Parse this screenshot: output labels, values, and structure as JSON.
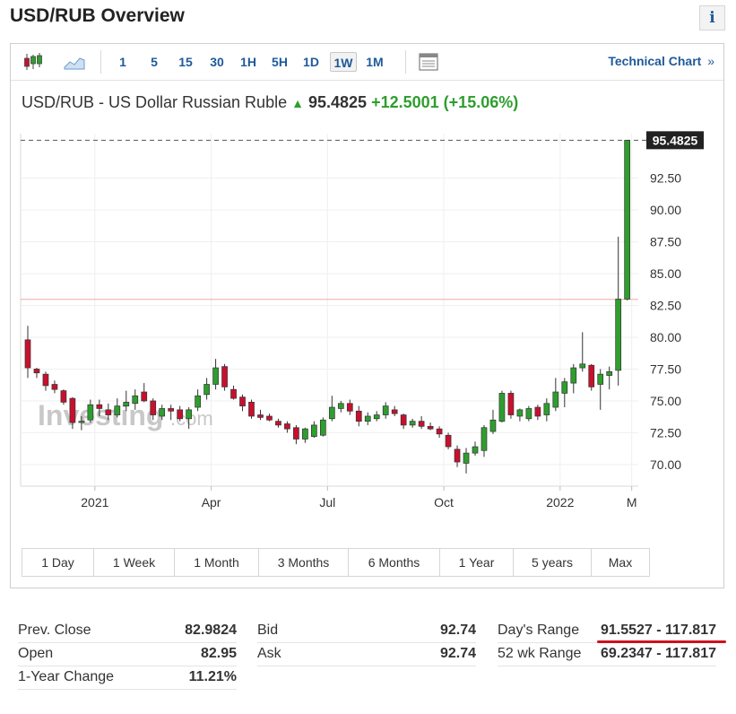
{
  "page": {
    "title": "USD/RUB Overview",
    "info_icon": "i"
  },
  "toolbar": {
    "candles_icon": "candlestick-chart-icon",
    "area_icon": "area-chart-icon",
    "intervals": [
      "1",
      "5",
      "15",
      "30",
      "1H",
      "5H",
      "1D",
      "1W",
      "1M"
    ],
    "active_interval": "1W",
    "layout_icon": "chart-layout-icon",
    "technical_link": "Technical Chart",
    "technical_arrow": "»"
  },
  "header": {
    "name": "USD/RUB - US Dollar Russian Ruble",
    "arrow": "▲",
    "price": "95.4825",
    "change": "+12.5001",
    "change_pct": "(+15.06%)"
  },
  "colors": {
    "up": "#2e9e2e",
    "down": "#c8102e",
    "link": "#1f5a99",
    "prev_close_line": "#f2a8a8"
  },
  "watermark": {
    "text": "Investing",
    "suffix": ".com"
  },
  "chart_data": {
    "type": "candlestick",
    "title": "",
    "ylim": [
      68.3,
      96.0
    ],
    "y_ticks": [
      "70.00",
      "72.50",
      "75.00",
      "77.50",
      "80.00",
      "82.50",
      "85.00",
      "87.50",
      "90.00",
      "92.50"
    ],
    "y_tick_values": [
      70,
      72.5,
      75,
      77.5,
      80,
      82.5,
      85,
      87.5,
      90,
      92.5
    ],
    "x_ticks": [
      "2021",
      "Apr",
      "Jul",
      "Oct",
      "2022",
      "M"
    ],
    "x_tick_index": [
      8,
      21,
      34,
      47,
      60,
      68
    ],
    "last_price_label": "95.4825",
    "last_price": 95.4825,
    "prev_close": 82.9824,
    "grid": true,
    "candles": [
      {
        "o": 79.8,
        "h": 80.9,
        "l": 76.8,
        "c": 77.6
      },
      {
        "o": 77.5,
        "h": 77.6,
        "l": 76.8,
        "c": 77.2
      },
      {
        "o": 77.1,
        "h": 77.3,
        "l": 75.8,
        "c": 76.2
      },
      {
        "o": 76.3,
        "h": 76.6,
        "l": 75.6,
        "c": 75.9
      },
      {
        "o": 75.8,
        "h": 75.9,
        "l": 74.7,
        "c": 74.9
      },
      {
        "o": 75.2,
        "h": 75.3,
        "l": 72.8,
        "c": 73.3
      },
      {
        "o": 73.3,
        "h": 73.8,
        "l": 72.7,
        "c": 73.4
      },
      {
        "o": 73.5,
        "h": 75.1,
        "l": 73.3,
        "c": 74.7
      },
      {
        "o": 74.7,
        "h": 75.1,
        "l": 73.8,
        "c": 74.4
      },
      {
        "o": 74.3,
        "h": 74.8,
        "l": 73.5,
        "c": 73.9
      },
      {
        "o": 73.9,
        "h": 75.2,
        "l": 73.7,
        "c": 74.6
      },
      {
        "o": 74.6,
        "h": 75.8,
        "l": 74.2,
        "c": 74.9
      },
      {
        "o": 74.8,
        "h": 75.9,
        "l": 74.3,
        "c": 75.4
      },
      {
        "o": 75.7,
        "h": 76.4,
        "l": 74.9,
        "c": 75.0
      },
      {
        "o": 75.0,
        "h": 75.2,
        "l": 73.5,
        "c": 73.9
      },
      {
        "o": 73.8,
        "h": 74.7,
        "l": 73.5,
        "c": 74.4
      },
      {
        "o": 74.4,
        "h": 74.7,
        "l": 73.5,
        "c": 74.2
      },
      {
        "o": 74.3,
        "h": 74.6,
        "l": 73.4,
        "c": 73.6
      },
      {
        "o": 73.6,
        "h": 74.5,
        "l": 72.8,
        "c": 74.3
      },
      {
        "o": 74.5,
        "h": 75.9,
        "l": 74.2,
        "c": 75.4
      },
      {
        "o": 75.5,
        "h": 76.8,
        "l": 75.1,
        "c": 76.3
      },
      {
        "o": 76.3,
        "h": 78.3,
        "l": 75.9,
        "c": 77.6
      },
      {
        "o": 77.7,
        "h": 77.9,
        "l": 75.8,
        "c": 76.1
      },
      {
        "o": 75.9,
        "h": 76.2,
        "l": 75.1,
        "c": 75.2
      },
      {
        "o": 75.3,
        "h": 75.5,
        "l": 74.2,
        "c": 74.6
      },
      {
        "o": 74.9,
        "h": 75.1,
        "l": 73.6,
        "c": 73.8
      },
      {
        "o": 73.9,
        "h": 74.3,
        "l": 73.5,
        "c": 73.7
      },
      {
        "o": 73.8,
        "h": 74.0,
        "l": 73.4,
        "c": 73.5
      },
      {
        "o": 73.4,
        "h": 73.6,
        "l": 72.9,
        "c": 73.1
      },
      {
        "o": 73.2,
        "h": 73.4,
        "l": 72.5,
        "c": 72.8
      },
      {
        "o": 72.9,
        "h": 73.1,
        "l": 71.6,
        "c": 72.0
      },
      {
        "o": 72.0,
        "h": 72.9,
        "l": 71.7,
        "c": 72.8
      },
      {
        "o": 72.2,
        "h": 73.4,
        "l": 72.1,
        "c": 73.1
      },
      {
        "o": 72.3,
        "h": 73.7,
        "l": 72.2,
        "c": 73.5
      },
      {
        "o": 73.6,
        "h": 75.4,
        "l": 73.4,
        "c": 74.5
      },
      {
        "o": 74.4,
        "h": 75.0,
        "l": 74.1,
        "c": 74.8
      },
      {
        "o": 74.8,
        "h": 75.1,
        "l": 73.9,
        "c": 74.2
      },
      {
        "o": 74.2,
        "h": 74.6,
        "l": 73.0,
        "c": 73.4
      },
      {
        "o": 73.4,
        "h": 74.1,
        "l": 73.1,
        "c": 73.8
      },
      {
        "o": 73.6,
        "h": 74.2,
        "l": 73.4,
        "c": 73.9
      },
      {
        "o": 73.9,
        "h": 74.9,
        "l": 73.6,
        "c": 74.6
      },
      {
        "o": 74.3,
        "h": 74.6,
        "l": 73.8,
        "c": 74.0
      },
      {
        "o": 73.9,
        "h": 74.0,
        "l": 72.8,
        "c": 73.1
      },
      {
        "o": 73.1,
        "h": 73.6,
        "l": 72.9,
        "c": 73.4
      },
      {
        "o": 73.4,
        "h": 73.8,
        "l": 72.8,
        "c": 73.0
      },
      {
        "o": 73.0,
        "h": 73.3,
        "l": 72.7,
        "c": 72.8
      },
      {
        "o": 72.8,
        "h": 73.0,
        "l": 72.1,
        "c": 72.4
      },
      {
        "o": 72.3,
        "h": 72.5,
        "l": 71.2,
        "c": 71.4
      },
      {
        "o": 71.2,
        "h": 71.5,
        "l": 69.8,
        "c": 70.2
      },
      {
        "o": 70.1,
        "h": 71.3,
        "l": 69.3,
        "c": 70.9
      },
      {
        "o": 70.9,
        "h": 71.8,
        "l": 70.7,
        "c": 71.4
      },
      {
        "o": 71.1,
        "h": 73.1,
        "l": 70.6,
        "c": 72.9
      },
      {
        "o": 72.6,
        "h": 74.3,
        "l": 72.4,
        "c": 73.5
      },
      {
        "o": 73.4,
        "h": 75.8,
        "l": 73.3,
        "c": 75.6
      },
      {
        "o": 75.6,
        "h": 75.8,
        "l": 73.6,
        "c": 73.9
      },
      {
        "o": 73.8,
        "h": 74.4,
        "l": 73.4,
        "c": 74.3
      },
      {
        "o": 73.6,
        "h": 74.6,
        "l": 73.4,
        "c": 74.4
      },
      {
        "o": 74.5,
        "h": 74.7,
        "l": 73.5,
        "c": 73.8
      },
      {
        "o": 73.9,
        "h": 75.2,
        "l": 73.4,
        "c": 74.8
      },
      {
        "o": 74.5,
        "h": 76.8,
        "l": 74.2,
        "c": 75.7
      },
      {
        "o": 75.6,
        "h": 76.8,
        "l": 74.5,
        "c": 76.5
      },
      {
        "o": 76.4,
        "h": 77.9,
        "l": 75.6,
        "c": 77.6
      },
      {
        "o": 77.6,
        "h": 80.4,
        "l": 77.3,
        "c": 77.9
      },
      {
        "o": 77.8,
        "h": 77.9,
        "l": 75.8,
        "c": 76.1
      },
      {
        "o": 76.3,
        "h": 77.5,
        "l": 74.3,
        "c": 77.1
      },
      {
        "o": 77.0,
        "h": 77.7,
        "l": 75.9,
        "c": 77.3
      },
      {
        "o": 77.4,
        "h": 87.9,
        "l": 76.2,
        "c": 83.0
      },
      {
        "o": 83.0,
        "h": 95.5,
        "l": 82.9,
        "c": 95.4825
      }
    ]
  },
  "ranges": [
    "1 Day",
    "1 Week",
    "1 Month",
    "3 Months",
    "6 Months",
    "1 Year",
    "5 years",
    "Max"
  ],
  "stats": {
    "prev_close_label": "Prev. Close",
    "prev_close_value": "82.9824",
    "open_label": "Open",
    "open_value": "82.95",
    "year_change_label": "1-Year Change",
    "year_change_value": "11.21%",
    "bid_label": "Bid",
    "bid_value": "92.74",
    "ask_label": "Ask",
    "ask_value": "92.74",
    "days_range_label": "Day's Range",
    "days_range_value": "91.5527 - 117.817",
    "wk52_label": "52 wk Range",
    "wk52_value": "69.2347 - 117.817"
  }
}
